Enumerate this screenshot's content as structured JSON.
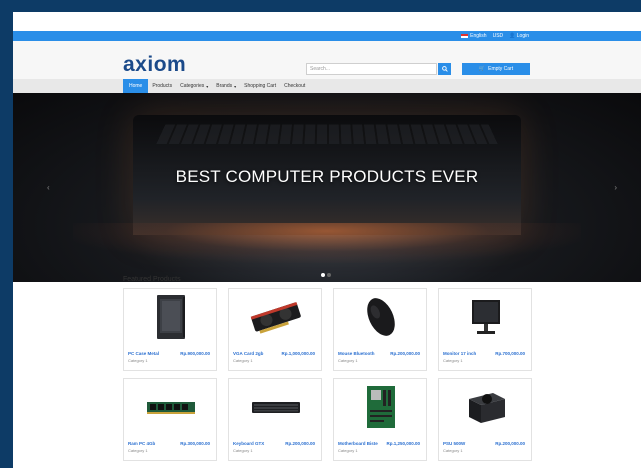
{
  "topbar": {
    "language": "English",
    "currency": "USD",
    "login": "Login"
  },
  "header": {
    "logo": "axiom",
    "search_placeholder": "Search...",
    "cart_label": "Empty Cart"
  },
  "nav": {
    "items": [
      {
        "label": "Home",
        "active": true,
        "dropdown": false
      },
      {
        "label": "Products",
        "active": false,
        "dropdown": false
      },
      {
        "label": "Categories",
        "active": false,
        "dropdown": true
      },
      {
        "label": "Brands",
        "active": false,
        "dropdown": true
      },
      {
        "label": "Shopping Cart",
        "active": false,
        "dropdown": false
      },
      {
        "label": "Checkout",
        "active": false,
        "dropdown": false
      }
    ]
  },
  "hero": {
    "title": "BEST COMPUTER PRODUCTS EVER"
  },
  "featured": {
    "title": "Featured Products",
    "products": [
      {
        "name": "PC Case Metal",
        "price": "Rp.900,000.00",
        "category": "Category 1",
        "icon": "pc-case-icon"
      },
      {
        "name": "VGA Card 2gb",
        "price": "Rp.1,000,000.00",
        "category": "Category 1",
        "icon": "gpu-icon"
      },
      {
        "name": "Mouse Bluetooth",
        "price": "Rp.200,000.00",
        "category": "Category 1",
        "icon": "mouse-icon"
      },
      {
        "name": "Monitor 17 inch",
        "price": "Rp.700,000.00",
        "category": "Category 1",
        "icon": "monitor-icon"
      },
      {
        "name": "Ram PC 4Gb",
        "price": "Rp.300,000.00",
        "category": "Category 1",
        "icon": "ram-icon"
      },
      {
        "name": "Keyboard GTX",
        "price": "Rp.200,000.00",
        "category": "Category 1",
        "icon": "keyboard-icon"
      },
      {
        "name": "Motherboard Biste",
        "price": "Rp.1,250,000.00",
        "category": "Category 1",
        "icon": "motherboard-icon"
      },
      {
        "name": "PSU 500W",
        "price": "Rp.200,000.00",
        "category": "Category 1",
        "icon": "psu-icon"
      }
    ]
  },
  "colors": {
    "primary": "#2a8ee8",
    "logo": "#1b4a8a",
    "background": "#0d3b66"
  }
}
